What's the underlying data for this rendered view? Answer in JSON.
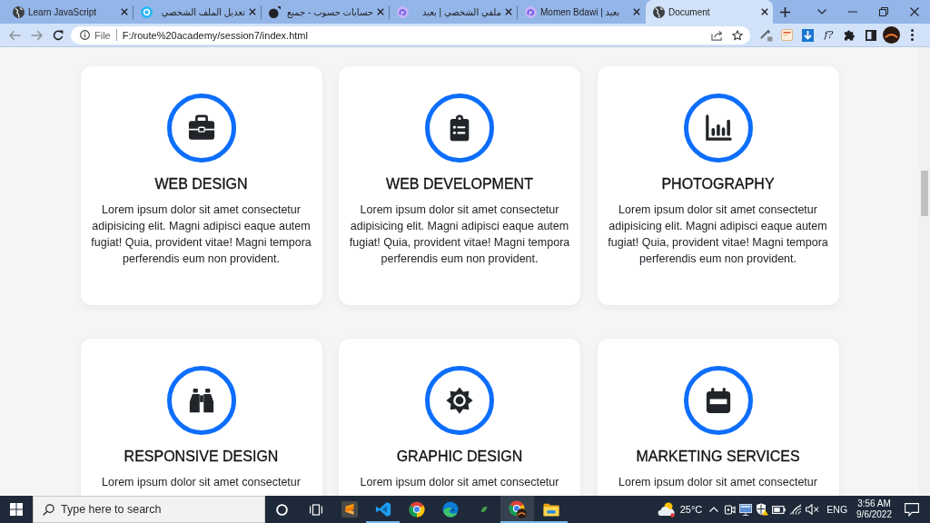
{
  "browser": {
    "tabs": [
      {
        "title": "Learn JavaScript",
        "selected": false
      },
      {
        "title": "تعديل الملف الشخصي",
        "selected": false
      },
      {
        "title": "حسابات حسوب - جميع",
        "selected": false
      },
      {
        "title": "ملفي الشخصي | بعيد",
        "selected": false
      },
      {
        "title": "Momen Bdawi | بعيد",
        "selected": false
      },
      {
        "title": "Document",
        "selected": true
      }
    ],
    "back": {
      "disabled": true
    },
    "forward": {
      "disabled": true
    },
    "address_bar": {
      "scheme": "File",
      "url": "F:/route%20academy/session7/index.html"
    },
    "extension_label": "f?"
  },
  "services": [
    {
      "title": "WEB DESIGN",
      "description": "Lorem ipsum dolor sit amet consectetur adipisicing elit. Magni adipisci eaque autem fugiat! Quia, provident vitae! Magni tempora perferendis eum non provident."
    },
    {
      "title": "WEB DEVELOPMENT",
      "description": "Lorem ipsum dolor sit amet consectetur adipisicing elit. Magni adipisci eaque autem fugiat! Quia, provident vitae! Magni tempora perferendis eum non provident."
    },
    {
      "title": "PHOTOGRAPHY",
      "description": "Lorem ipsum dolor sit amet consectetur adipisicing elit. Magni adipisci eaque autem fugiat! Quia, provident vitae! Magni tempora perferendis eum non provident."
    },
    {
      "title": "RESPONSIVE DESIGN",
      "description": "Lorem ipsum dolor sit amet consectetur"
    },
    {
      "title": "GRAPHIC DESIGN",
      "description": "Lorem ipsum dolor sit amet consectetur"
    },
    {
      "title": "MARKETING SERVICES",
      "description": "Lorem ipsum dolor sit amet consectetur"
    }
  ],
  "taskbar": {
    "search": {
      "placeholder": "Type here to search"
    },
    "apps": [
      {
        "open": false,
        "active": false
      },
      {
        "open": true,
        "active": false
      },
      {
        "open": false,
        "active": false
      },
      {
        "open": false,
        "active": false
      },
      {
        "open": false,
        "active": false
      },
      {
        "open": true,
        "active": true
      },
      {
        "open": true,
        "active": false
      }
    ],
    "weather": "25°C",
    "language": "ENG",
    "time": "3:56 AM",
    "date": "9/6/2022"
  }
}
